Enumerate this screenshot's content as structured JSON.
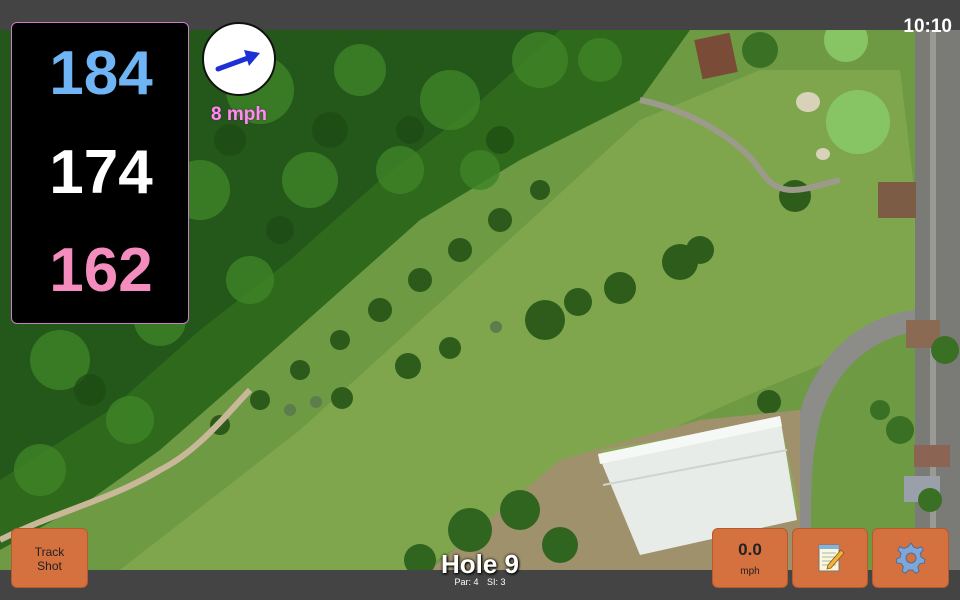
{
  "status": {
    "time": "10:10"
  },
  "distances": {
    "back": "184",
    "middle": "174",
    "front": "162"
  },
  "wind": {
    "speed_label": "8 mph",
    "direction_icon": "wind-arrow-icon",
    "arrow_color": "#1d2fd6"
  },
  "hole": {
    "title": "Hole 9",
    "par_label": "Par: 4",
    "si_label": "SI: 3"
  },
  "buttons": {
    "track_shot_line1": "Track",
    "track_shot_line2": "Shot",
    "speed_value": "0.0",
    "speed_unit": "mph",
    "notes_icon": "notepad-icon",
    "settings_icon": "gear-icon"
  },
  "colors": {
    "back_distance": "#6fb5f5",
    "middle_distance": "#ffffff",
    "front_distance": "#f48cbe",
    "button_accent": "#d5703f",
    "wind_label": "#ff8cf0"
  }
}
